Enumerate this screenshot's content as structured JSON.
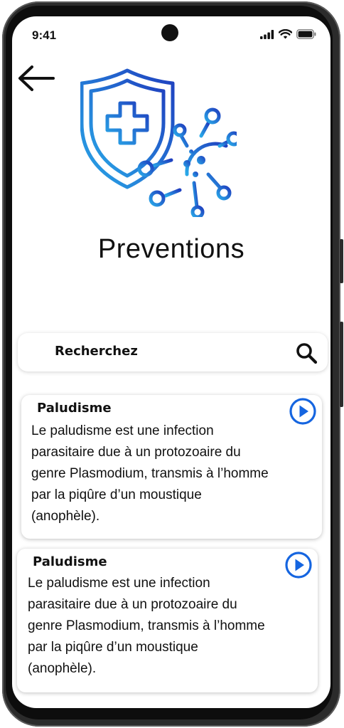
{
  "status": {
    "time": "9:41"
  },
  "header": {
    "title": "Preventions"
  },
  "search": {
    "placeholder": "Recherchez"
  },
  "cards": [
    {
      "title": "Paludisme",
      "lines": [
        "Le paludisme est une infection",
        "parasitaire due à un protozoaire du",
        "genre Plasmodium, transmis à l’homme",
        "par la piqûre d’un moustique",
        "(anophèle)."
      ]
    },
    {
      "title": "Paludisme",
      "lines": [
        "Le paludisme est une infection",
        "parasitaire due à un protozoaire du",
        "genre Plasmodium, transmis à l’homme",
        "par la piqûre d’un moustique",
        "(anophèle)."
      ]
    }
  ],
  "colors": {
    "accent": "#1565e0",
    "icon_gradient_start": "#29a8e8",
    "icon_gradient_end": "#1f3fbf"
  },
  "icons": {
    "back": "arrow-left-icon",
    "search": "search-icon",
    "play": "play-circle-icon",
    "hero": "shield-virus-icon"
  }
}
